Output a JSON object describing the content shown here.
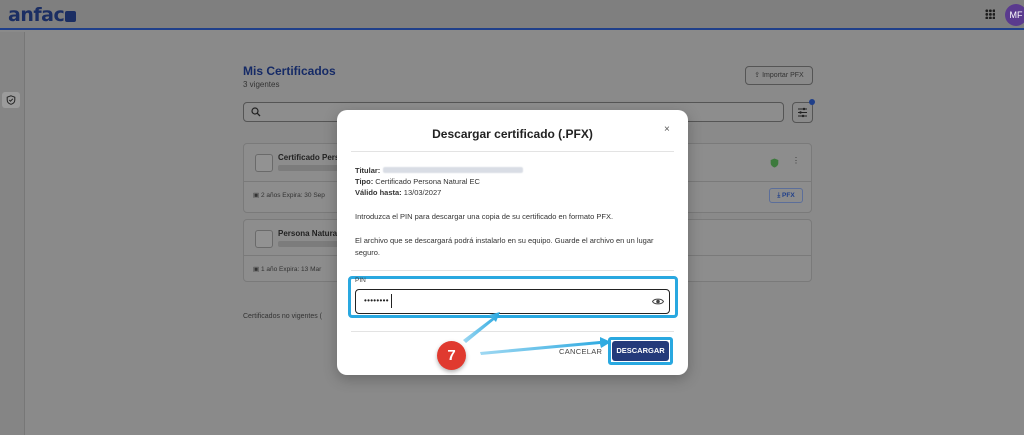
{
  "header": {
    "logo_text": "anf",
    "avatar_initials": "MF"
  },
  "page": {
    "title": "Mis Certificados",
    "subtitle": "3 vigentes",
    "import_button": "Importar PFX",
    "search_placeholder": ""
  },
  "certificates": [
    {
      "name": "Certificado Pers",
      "meta": "2 años   Expira: 30 Sep",
      "action": "PFX"
    },
    {
      "name": "Persona Natura",
      "meta": "1 año   Expira: 13 Mar"
    }
  ],
  "expired_label": "Certificados no vigentes (",
  "modal": {
    "title": "Descargar certificado (.PFX)",
    "close": "×",
    "holder_label": "Titular:",
    "type_label": "Tipo:",
    "type_value": "Certificado Persona Natural EC",
    "valid_label": "Válido hasta:",
    "valid_value": "13/03/2027",
    "instruction": "Introduzca el PIN para descargar una copia de su certificado en formato PFX.",
    "note": "El archivo que se descargará podrá instalarlo en su equipo. Guarde el archivo en un lugar seguro.",
    "pin_label": "PIN",
    "pin_value": "••••••••",
    "cancel_button": "CANCELAR",
    "download_button": "DESCARGAR"
  },
  "annotation": {
    "step_number": "7",
    "highlight_color": "#29a8e0",
    "badge_color": "#e03a2f"
  },
  "colors": {
    "brand_navy": "#1b2e63",
    "primary_button": "#243a7a"
  }
}
